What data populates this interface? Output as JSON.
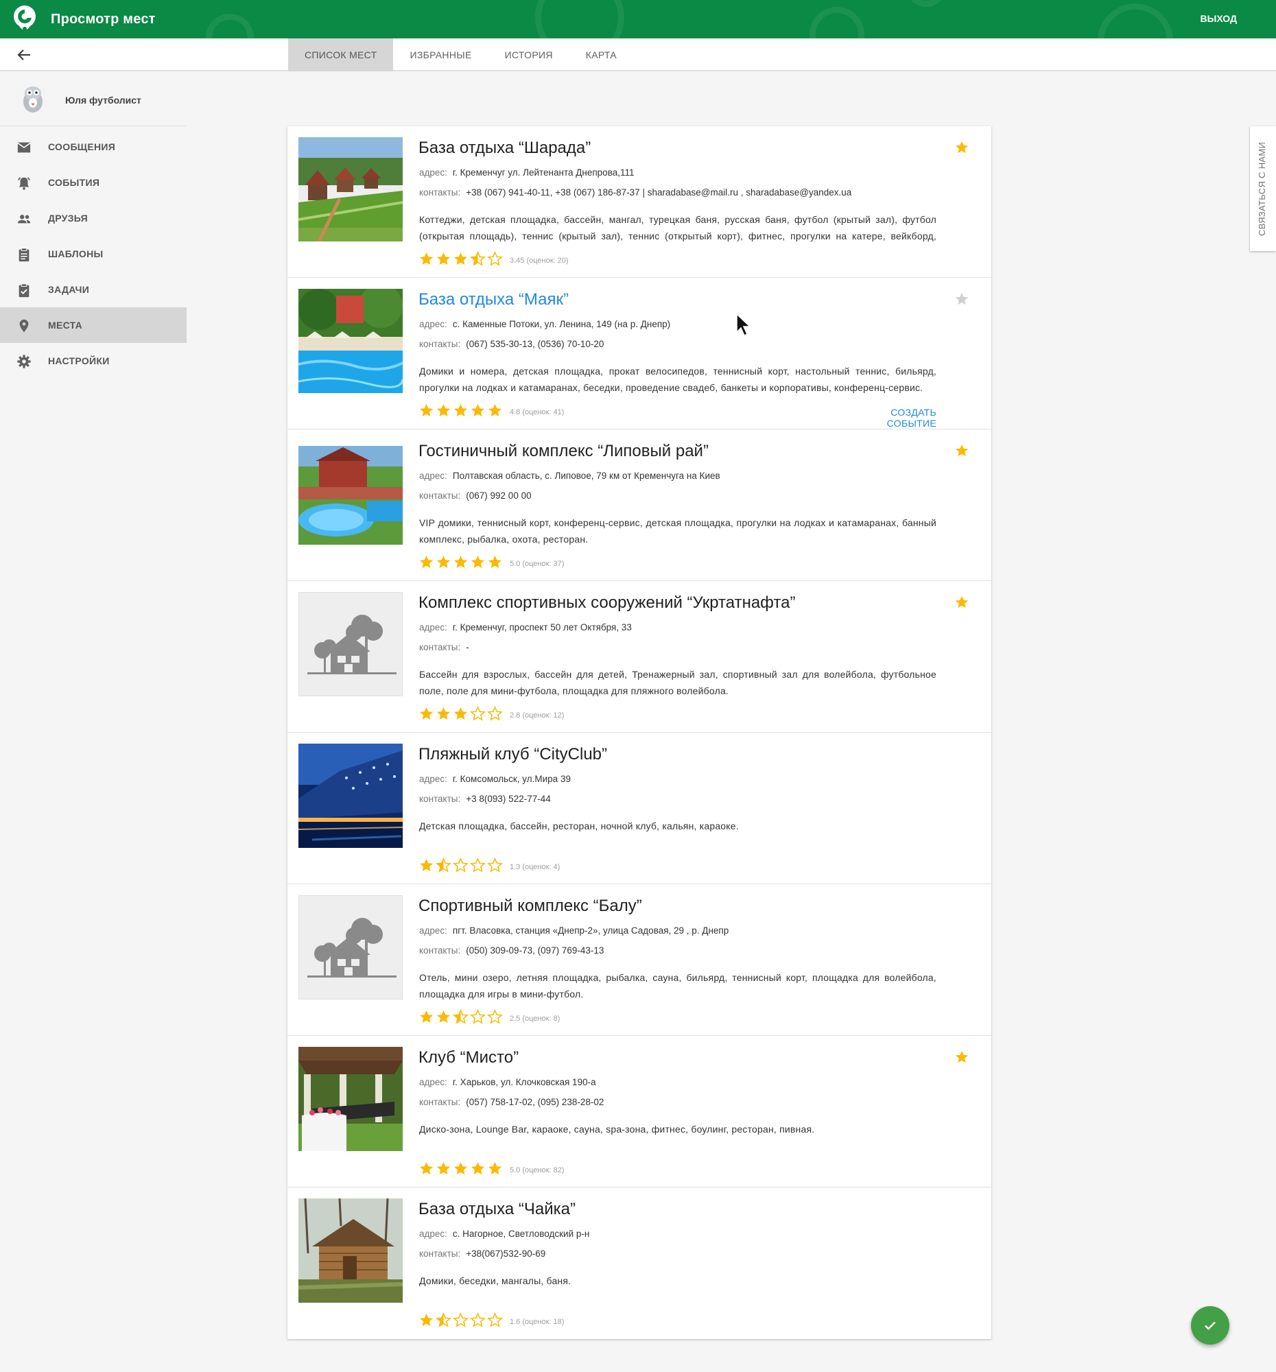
{
  "app": {
    "title": "Просмотр мест",
    "exit_label": "ВЫХОД",
    "brand_color": "#0a8a44"
  },
  "tabs": [
    {
      "label": "СПИСОК МЕСТ",
      "active": true
    },
    {
      "label": "ИЗБРАННЫЕ",
      "active": false
    },
    {
      "label": "ИСТОРИЯ",
      "active": false
    },
    {
      "label": "КАРТА",
      "active": false
    }
  ],
  "user": {
    "name": "Юля футболист"
  },
  "sidebar": {
    "items": [
      {
        "label": "СООБЩЕНИЯ",
        "icon": "mail-icon",
        "active": false
      },
      {
        "label": "СОБЫТИЯ",
        "icon": "alarm-icon",
        "active": false
      },
      {
        "label": "ДРУЗЬЯ",
        "icon": "people-icon",
        "active": false
      },
      {
        "label": "ШАБЛОНЫ",
        "icon": "clipboard-icon",
        "active": false
      },
      {
        "label": "ЗАДАЧИ",
        "icon": "task-check-icon",
        "active": false
      },
      {
        "label": "МЕСТА",
        "icon": "place-pin-icon",
        "active": true
      },
      {
        "label": "НАСТРОЙКИ",
        "icon": "gear-icon",
        "active": false
      }
    ]
  },
  "labels": {
    "address": "адрес:",
    "contacts": "контакты:",
    "create_event": "СОЗДАТЬ СОБЫТИЕ",
    "contact_us": "СВЯЗАТЬСЯ С НАМИ"
  },
  "places": [
    {
      "title": "База отдыха “Шарада”",
      "address": "г. Кременчуг ул. Лейтенанта Днепрова,111",
      "contacts": "+38 (067) 941-40-11, +38 (067) 186-87-37 | sharadabase@mail.ru , sharadabase@yandex.ua",
      "description": "Коттеджи, детская площадка, бассейн, мангал, турецкая баня, русская баня, футбол (крытый зал), футбол (открытая площадь), теннис (крытый зал), теннис (открытый корт), фитнес, прогулки на катере, вейкборд, рыб…",
      "rating": 3.45,
      "rating_text": "3.45 (оценок: 20)",
      "favorite": true,
      "image": "cottages-photo"
    },
    {
      "title": "База отдыха “Маяк”",
      "address": "с. Каменные Потоки, ул. Ленина, 149 (на р. Днепр)",
      "contacts": "(067) 535-30-13, (0536) 70-10-20",
      "description": "Домики и номера, детская площадка, прокат велосипедов, теннисный корт, настольный теннис, бильярд, прогулки на лодках и катамаранах, беседки, проведение свадеб, банкеты и корпоративы, конференц-сервис.",
      "rating": 4.8,
      "rating_text": "4.8 (оценок: 41)",
      "favorite": false,
      "image": "pool-photo",
      "hovered": true
    },
    {
      "title": "Гостиничный комплекс “Липовый рай”",
      "address": "Полтавская область, с. Липовое, 79 км от Кременчуга на Киев",
      "contacts": "(067) 992 00 00",
      "description": "VIP домики, теннисный корт, конференц-сервис, детская площадка, прогулки на лодках и катамаранах, банный комплекс, рыбалка, охота, ресторан.",
      "rating": 5.0,
      "rating_text": "5.0 (оценок: 37)",
      "favorite": true,
      "image": "resort-pool-photo"
    },
    {
      "title": "Комплекс спортивных сооружений “Укртатнафта”",
      "address": "г. Кременчуг, проспект 50 лет Октября, 33",
      "contacts": "-",
      "description": "Бассейн для взрослых, бассейн для детей, Тренажерный зал, спортивный зал для волейбола, футбольное поле, поле для мини-футбола, площадка для пляжного волейбола.",
      "rating": 2.8,
      "rating_text": "2.8 (оценок: 12)",
      "favorite": true,
      "image": "placeholder"
    },
    {
      "title": "Пляжный клуб “CityClub”",
      "address": "г. Комсомольск, ул.Мира 39",
      "contacts": "+3 8(093) 522-77-44",
      "description": "Детская площадка, бассейн, ресторан, ночной клуб, кальян, караоке.",
      "rating": 1.3,
      "rating_text": "1.3 (оценок: 4)",
      "favorite": false,
      "image": "night-club-photo"
    },
    {
      "title": "Спортивный комплекс “Балу”",
      "address": "пгт. Власовка, станция «Днепр-2», улица Садовая, 29 , р. Днепр",
      "contacts": "(050) 309-09-73, (097) 769-43-13",
      "description": "Отель, мини озеро, летняя площадка, рыбалка, сауна, бильярд, теннисный корт, площадка для волейбола, площадка для игры в мини-футбол.",
      "rating": 2.5,
      "rating_text": "2.5 (оценок: 8)",
      "favorite": false,
      "image": "placeholder"
    },
    {
      "title": "Клуб “Мисто”",
      "address": "г. Харьков, ул. Клочковская 190-а",
      "contacts": "(057) 758-17-02, (095) 238-28-02",
      "description": "Диско-зона, Lounge Bar, караоке, сауна, spa-зона, фитнес, боулинг, ресторан, пивная.",
      "rating": 5.0,
      "rating_text": "5.0 (оценок: 82)",
      "favorite": true,
      "image": "lounge-photo"
    },
    {
      "title": "База отдыха “Чайка”",
      "address": "с. Нагорное, Светловодский р-н",
      "contacts": "+38(067)532-90-69",
      "description": "Домики, беседки, мангалы, баня.",
      "rating": 1.6,
      "rating_text": "1.6 (оценок: 18)",
      "favorite": false,
      "image": "wooden-house-photo"
    }
  ],
  "colors": {
    "star": "#fbb900",
    "star_empty": "#bdbdbd",
    "link": "#1e88e5",
    "fab": "#43a047"
  }
}
